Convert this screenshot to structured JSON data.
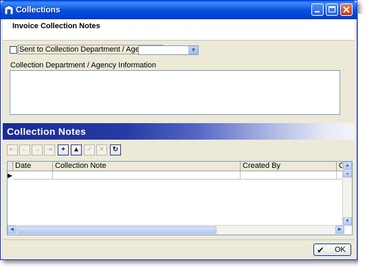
{
  "window": {
    "title": "Collections",
    "icons": [
      "app-icon",
      "minimize-icon",
      "maximize-icon",
      "close-icon"
    ]
  },
  "header": {
    "title": "Invoice Collection Notes"
  },
  "form": {
    "sent_label": "Sent to Collection Department / Agency on",
    "sent_checked": false,
    "date_value": "",
    "agency_label": "Collection Department / Agency Information",
    "agency_value": ""
  },
  "notes": {
    "section_title": "Collection Notes",
    "toolbar": [
      "first-record-icon",
      "previous-record-icon",
      "next-record-icon",
      "last-record-icon",
      "add-record-icon",
      "move-up-icon",
      "edit-record-icon",
      "delete-record-icon",
      "refresh-icon"
    ],
    "columns": [
      "Date",
      "Collection Note",
      "Created By",
      "Cr"
    ],
    "rows": [
      {
        "date": "",
        "note": "",
        "created_by": "",
        "cr": ""
      }
    ]
  },
  "footer": {
    "ok_label": "OK"
  },
  "colors": {
    "titlebar": "#0553e1",
    "band_start": "#1c2b93",
    "window_bg": "#ece9d8"
  }
}
